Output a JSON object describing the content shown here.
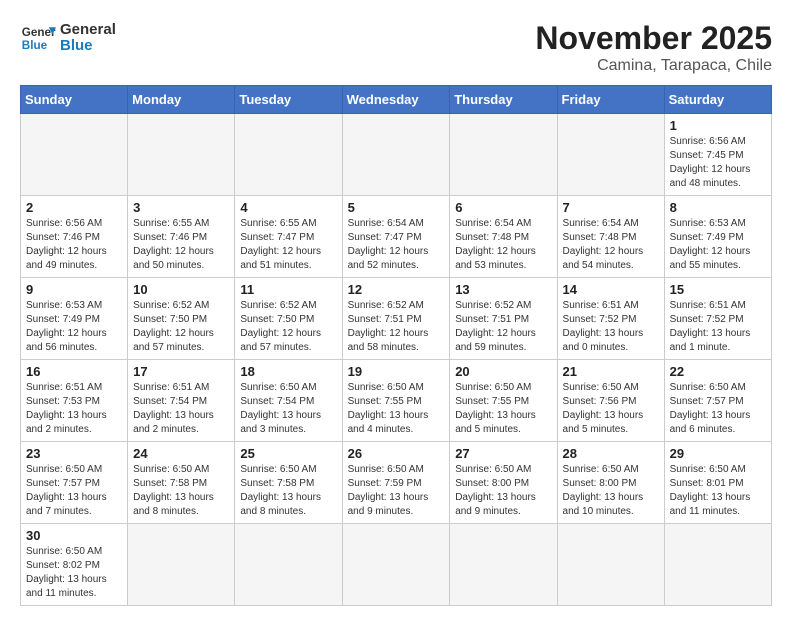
{
  "header": {
    "logo_general": "General",
    "logo_blue": "Blue",
    "month_year": "November 2025",
    "location": "Camina, Tarapaca, Chile"
  },
  "days_of_week": [
    "Sunday",
    "Monday",
    "Tuesday",
    "Wednesday",
    "Thursday",
    "Friday",
    "Saturday"
  ],
  "weeks": [
    [
      {
        "day": "",
        "info": ""
      },
      {
        "day": "",
        "info": ""
      },
      {
        "day": "",
        "info": ""
      },
      {
        "day": "",
        "info": ""
      },
      {
        "day": "",
        "info": ""
      },
      {
        "day": "",
        "info": ""
      },
      {
        "day": "1",
        "info": "Sunrise: 6:56 AM\nSunset: 7:45 PM\nDaylight: 12 hours and 48 minutes."
      }
    ],
    [
      {
        "day": "2",
        "info": "Sunrise: 6:56 AM\nSunset: 7:46 PM\nDaylight: 12 hours and 49 minutes."
      },
      {
        "day": "3",
        "info": "Sunrise: 6:55 AM\nSunset: 7:46 PM\nDaylight: 12 hours and 50 minutes."
      },
      {
        "day": "4",
        "info": "Sunrise: 6:55 AM\nSunset: 7:47 PM\nDaylight: 12 hours and 51 minutes."
      },
      {
        "day": "5",
        "info": "Sunrise: 6:54 AM\nSunset: 7:47 PM\nDaylight: 12 hours and 52 minutes."
      },
      {
        "day": "6",
        "info": "Sunrise: 6:54 AM\nSunset: 7:48 PM\nDaylight: 12 hours and 53 minutes."
      },
      {
        "day": "7",
        "info": "Sunrise: 6:54 AM\nSunset: 7:48 PM\nDaylight: 12 hours and 54 minutes."
      },
      {
        "day": "8",
        "info": "Sunrise: 6:53 AM\nSunset: 7:49 PM\nDaylight: 12 hours and 55 minutes."
      }
    ],
    [
      {
        "day": "9",
        "info": "Sunrise: 6:53 AM\nSunset: 7:49 PM\nDaylight: 12 hours and 56 minutes."
      },
      {
        "day": "10",
        "info": "Sunrise: 6:52 AM\nSunset: 7:50 PM\nDaylight: 12 hours and 57 minutes."
      },
      {
        "day": "11",
        "info": "Sunrise: 6:52 AM\nSunset: 7:50 PM\nDaylight: 12 hours and 57 minutes."
      },
      {
        "day": "12",
        "info": "Sunrise: 6:52 AM\nSunset: 7:51 PM\nDaylight: 12 hours and 58 minutes."
      },
      {
        "day": "13",
        "info": "Sunrise: 6:52 AM\nSunset: 7:51 PM\nDaylight: 12 hours and 59 minutes."
      },
      {
        "day": "14",
        "info": "Sunrise: 6:51 AM\nSunset: 7:52 PM\nDaylight: 13 hours and 0 minutes."
      },
      {
        "day": "15",
        "info": "Sunrise: 6:51 AM\nSunset: 7:52 PM\nDaylight: 13 hours and 1 minute."
      }
    ],
    [
      {
        "day": "16",
        "info": "Sunrise: 6:51 AM\nSunset: 7:53 PM\nDaylight: 13 hours and 2 minutes."
      },
      {
        "day": "17",
        "info": "Sunrise: 6:51 AM\nSunset: 7:54 PM\nDaylight: 13 hours and 2 minutes."
      },
      {
        "day": "18",
        "info": "Sunrise: 6:50 AM\nSunset: 7:54 PM\nDaylight: 13 hours and 3 minutes."
      },
      {
        "day": "19",
        "info": "Sunrise: 6:50 AM\nSunset: 7:55 PM\nDaylight: 13 hours and 4 minutes."
      },
      {
        "day": "20",
        "info": "Sunrise: 6:50 AM\nSunset: 7:55 PM\nDaylight: 13 hours and 5 minutes."
      },
      {
        "day": "21",
        "info": "Sunrise: 6:50 AM\nSunset: 7:56 PM\nDaylight: 13 hours and 5 minutes."
      },
      {
        "day": "22",
        "info": "Sunrise: 6:50 AM\nSunset: 7:57 PM\nDaylight: 13 hours and 6 minutes."
      }
    ],
    [
      {
        "day": "23",
        "info": "Sunrise: 6:50 AM\nSunset: 7:57 PM\nDaylight: 13 hours and 7 minutes."
      },
      {
        "day": "24",
        "info": "Sunrise: 6:50 AM\nSunset: 7:58 PM\nDaylight: 13 hours and 8 minutes."
      },
      {
        "day": "25",
        "info": "Sunrise: 6:50 AM\nSunset: 7:58 PM\nDaylight: 13 hours and 8 minutes."
      },
      {
        "day": "26",
        "info": "Sunrise: 6:50 AM\nSunset: 7:59 PM\nDaylight: 13 hours and 9 minutes."
      },
      {
        "day": "27",
        "info": "Sunrise: 6:50 AM\nSunset: 8:00 PM\nDaylight: 13 hours and 9 minutes."
      },
      {
        "day": "28",
        "info": "Sunrise: 6:50 AM\nSunset: 8:00 PM\nDaylight: 13 hours and 10 minutes."
      },
      {
        "day": "29",
        "info": "Sunrise: 6:50 AM\nSunset: 8:01 PM\nDaylight: 13 hours and 11 minutes."
      }
    ],
    [
      {
        "day": "30",
        "info": "Sunrise: 6:50 AM\nSunset: 8:02 PM\nDaylight: 13 hours and 11 minutes."
      },
      {
        "day": "",
        "info": ""
      },
      {
        "day": "",
        "info": ""
      },
      {
        "day": "",
        "info": ""
      },
      {
        "day": "",
        "info": ""
      },
      {
        "day": "",
        "info": ""
      },
      {
        "day": "",
        "info": ""
      }
    ]
  ]
}
